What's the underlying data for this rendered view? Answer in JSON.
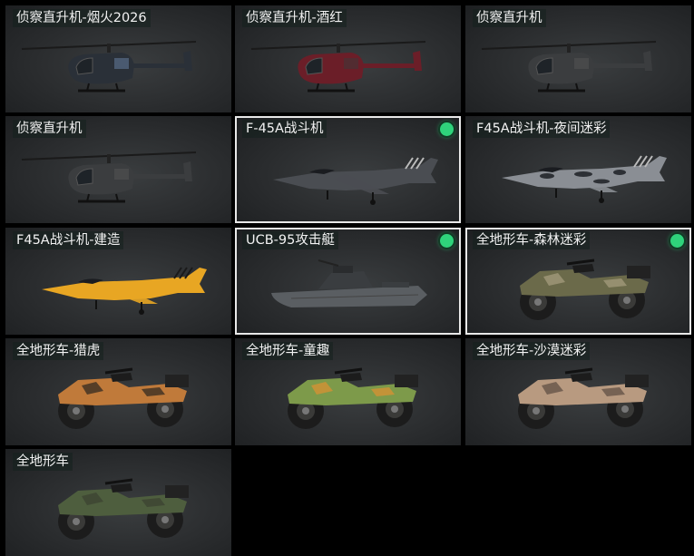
{
  "vehicles": [
    {
      "title": "侦察直升机-烟火2026",
      "kind": "heli",
      "body": "#2a3038",
      "accent": "#6a84a8",
      "selected": false
    },
    {
      "title": "侦察直升机-酒红",
      "kind": "heli",
      "body": "#6b1e28",
      "accent": "#3a3a3a",
      "selected": false
    },
    {
      "title": "侦察直升机",
      "kind": "heli",
      "body": "#3b3d3f",
      "accent": "#555",
      "selected": false
    },
    {
      "title": "侦察直升机",
      "kind": "heli",
      "body": "#3b3d3f",
      "accent": "#555",
      "selected": false
    },
    {
      "title": "F-45A战斗机",
      "kind": "jet",
      "body": "#4a4d52",
      "accent": "#6a6d72",
      "selected": true
    },
    {
      "title": "F45A战斗机-夜间迷彩",
      "kind": "jet",
      "body": "#8a8e94",
      "accent": "#2d3035",
      "selected": false
    },
    {
      "title": "F45A战斗机-建造",
      "kind": "jet",
      "body": "#e8a623",
      "accent": "#222",
      "selected": false
    },
    {
      "title": "UCB-95攻击艇",
      "kind": "boat",
      "body": "#5a5e62",
      "accent": "#3a3d40",
      "selected": true
    },
    {
      "title": "全地形车-森林迷彩",
      "kind": "atv",
      "body": "#6b6a4a",
      "accent": "#a8a080",
      "selected": true
    },
    {
      "title": "全地形车-猎虎",
      "kind": "atv",
      "body": "#c07a3a",
      "accent": "#2a2520",
      "selected": false
    },
    {
      "title": "全地形车-童趣",
      "kind": "atv",
      "body": "#7d9a4a",
      "accent": "#e09030",
      "selected": false
    },
    {
      "title": "全地形车-沙漠迷彩",
      "kind": "atv",
      "body": "#b89a80",
      "accent": "#5a4a40",
      "selected": false
    },
    {
      "title": "全地形车",
      "kind": "atv",
      "body": "#4e5e3e",
      "accent": "#3a4030",
      "selected": false
    }
  ],
  "icons": {
    "selected": "equipped-dot-icon"
  }
}
